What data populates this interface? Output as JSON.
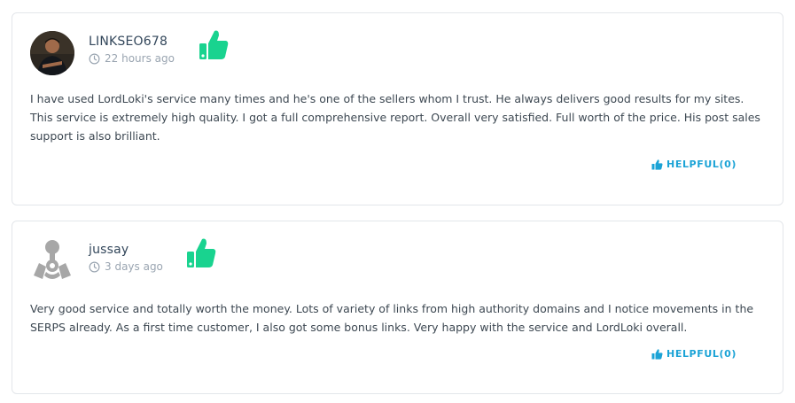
{
  "reviews": [
    {
      "username": "LINKSEO678",
      "time_ago": "22 hours ago",
      "text": "I have used LordLoki's service many times and he's one of the sellers whom I trust. He always delivers good results for my sites. This service is extremely high quality. I got a full comprehensive report. Overall very satisfied. Full worth of the price. His post sales support is also brilliant.",
      "helpful_label": "HELPFUL(0)",
      "rating": "positive",
      "avatar": "user-photo"
    },
    {
      "username": "jussay",
      "time_ago": "3 days ago",
      "text": "Very good service and totally worth the money. Lots of variety of links from high authority domains and I notice movements in the SERPS already. As a first time customer, I also got some bonus links. Very happy with the service and LordLoki overall.",
      "helpful_label": "HELPFUL(0)",
      "rating": "positive",
      "avatar": "default-avatar"
    }
  ],
  "colors": {
    "thumb_green": "#19d38f",
    "helpful_blue": "#1ba3d6",
    "muted_text": "#9aa5b1"
  }
}
